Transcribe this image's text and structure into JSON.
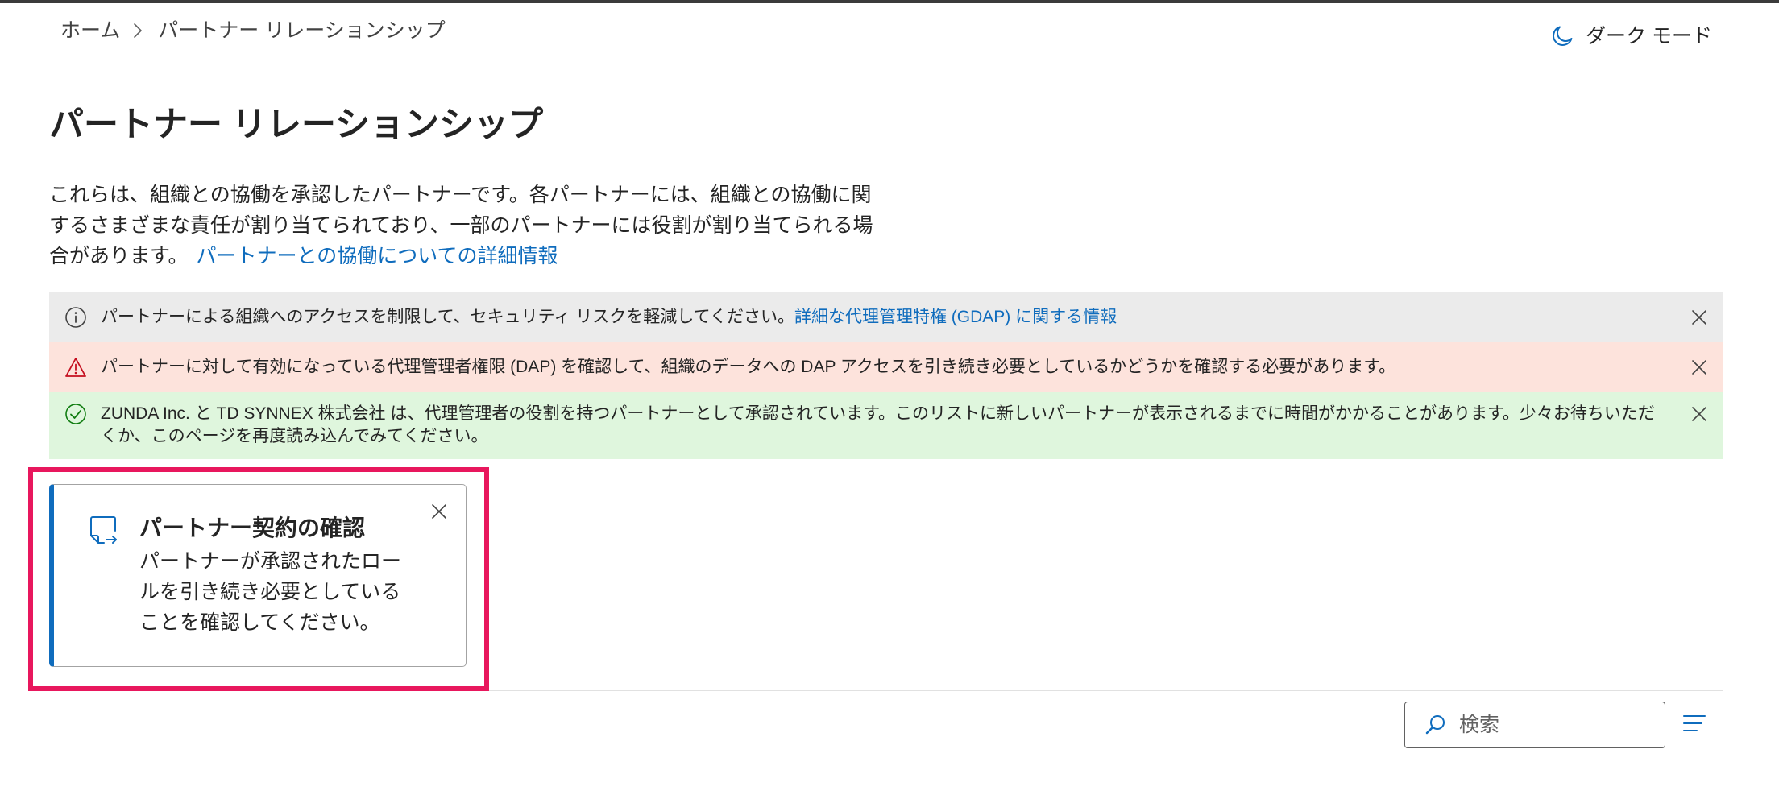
{
  "breadcrumb": {
    "items": [
      {
        "label": "ホーム"
      },
      {
        "label": "パートナー リレーションシップ"
      }
    ]
  },
  "header": {
    "dark_mode": {
      "label": "ダーク モード",
      "icon": "moon-icon"
    }
  },
  "page": {
    "title": "パートナー リレーションシップ",
    "description": "これらは、組織との協働を承認したパートナーです。各パートナーには、組織との協働に関するさまざまな責任が割り当てられており、一部のパートナーには役割が割り当てられる場合があります。",
    "learn_more_link": "パートナーとの協働についての詳細情報"
  },
  "banners": [
    {
      "type": "info",
      "icon": "info-icon",
      "text": "パートナーによる組織へのアクセスを制限して、セキュリティ リスクを軽減してください。",
      "link": "詳細な代理管理特権 (GDAP) に関する情報"
    },
    {
      "type": "warning",
      "icon": "warning-icon",
      "text": "パートナーに対して有効になっている代理管理者権限 (DAP) を確認して、組織のデータへの DAP アクセスを引き続き必要としているかどうかを確認する必要があります。"
    },
    {
      "type": "success",
      "icon": "checkmark-circle-icon",
      "text": "ZUNDA Inc. と TD SYNNEX 株式会社 は、代理管理者の役割を持つパートナーとして承認されています。このリストに新しいパートナーが表示されるまでに時間がかかることがあります。少々お待ちいただくか、このページを再度読み込んでみてください。"
    }
  ],
  "review_card": {
    "icon": "document-arrow-icon",
    "title": "パートナー契約の確認",
    "body": "パートナーが承認されたロールを引き続き必要としていることを確認してください。"
  },
  "toolbar": {
    "search": {
      "placeholder": "検索",
      "value": "",
      "icon": "search-icon"
    },
    "filter_icon": "filter-icon"
  },
  "colors": {
    "accent": "#0f6cbd",
    "highlight": "#e8175d",
    "info_bg": "#ebebeb",
    "warning_bg": "#fde3dc",
    "warning": "#c50f1f",
    "success_bg": "#dff6dd",
    "success": "#107c10"
  }
}
